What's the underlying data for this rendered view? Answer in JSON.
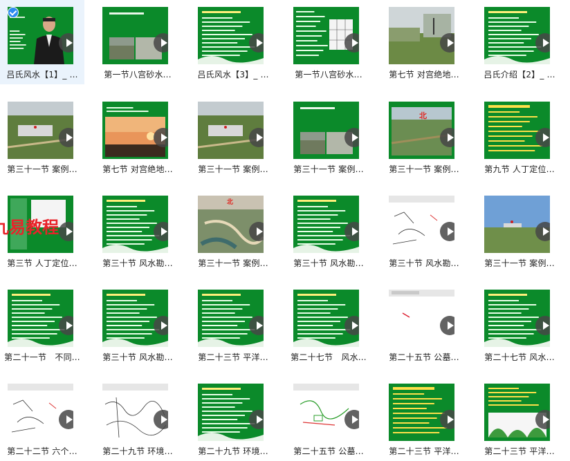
{
  "watermark_text": "九易教程",
  "colors": {
    "selected_tile_bg": "#eaf3fc",
    "slide_green": "#0b8a2a",
    "play_button": "#464646"
  },
  "videos": [
    {
      "caption": "吕氏风水【1】_ ...",
      "scene": "presenter",
      "selected": true
    },
    {
      "caption": "第一节八宫砂水...",
      "scene": "green-photo"
    },
    {
      "caption": "吕氏风水【3】_ ...",
      "scene": "green-text"
    },
    {
      "caption": "第一节八宫砂水...",
      "scene": "green-diagram"
    },
    {
      "caption": "第七节 对宫绝地...",
      "scene": "landscape"
    },
    {
      "caption": "吕氏介绍【2】_ ...",
      "scene": "green-text"
    },
    {
      "caption": "第三十一节 案例...",
      "scene": "aerial"
    },
    {
      "caption": "第七节 对宫绝地...",
      "scene": "sunset"
    },
    {
      "caption": "第三十一节 案例...",
      "scene": "aerial"
    },
    {
      "caption": "第三十一节 案例...",
      "scene": "green-photo"
    },
    {
      "caption": "第三十一节 案例...",
      "scene": "aerial-north"
    },
    {
      "caption": "第九节 人丁定位...",
      "scene": "green-yellow"
    },
    {
      "caption": "第三节 人丁定位...",
      "scene": "watermark"
    },
    {
      "caption": "第三十节 风水勘...",
      "scene": "green-text"
    },
    {
      "caption": "第三十一节 案例...",
      "scene": "aerial-town"
    },
    {
      "caption": "第三十节 风水勘...",
      "scene": "green-text"
    },
    {
      "caption": "第三十节 风水勘...",
      "scene": "sketch"
    },
    {
      "caption": "第三十一节 案例...",
      "scene": "sky-field"
    },
    {
      "caption": "第二十一节　不同...",
      "scene": "green-text"
    },
    {
      "caption": "第三十节 风水勘...",
      "scene": "green-text"
    },
    {
      "caption": "第二十三节 平洋...",
      "scene": "green-text"
    },
    {
      "caption": "第二十七节　风水...",
      "scene": "green-text"
    },
    {
      "caption": "第二十五节 公墓...",
      "scene": "whiteboard"
    },
    {
      "caption": "第二十七节 风水...",
      "scene": "green-text"
    },
    {
      "caption": "第二十二节 六个...",
      "scene": "sketch"
    },
    {
      "caption": "第二十九节 环境...",
      "scene": "sketch-dense"
    },
    {
      "caption": "第二十九节 环境...",
      "scene": "green-text"
    },
    {
      "caption": "第二十五节 公墓...",
      "scene": "sketch-color"
    },
    {
      "caption": "第二十三节 平洋...",
      "scene": "green-yellow"
    },
    {
      "caption": "第二十三节 平洋...",
      "scene": "green-hills"
    }
  ]
}
